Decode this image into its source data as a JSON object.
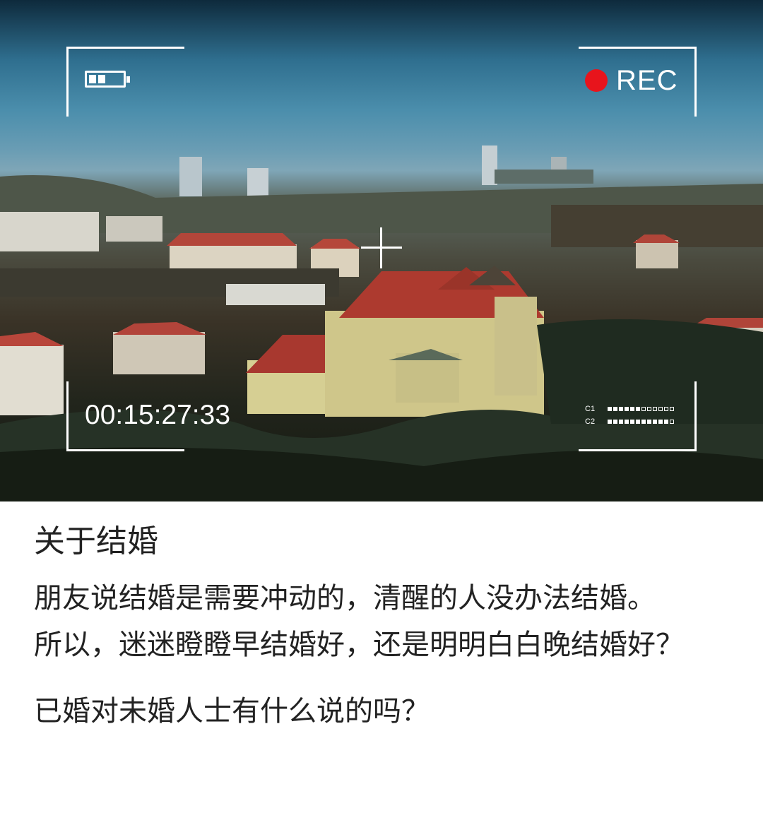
{
  "camera_overlay": {
    "battery_icon": "battery-icon",
    "battery_level": 0.66,
    "rec_label": "REC",
    "rec_color": "#e8141c",
    "timecode": "00:15:27:33",
    "channels": [
      {
        "label": "C1",
        "level": 0.5
      },
      {
        "label": "C2",
        "level": 0.9
      }
    ]
  },
  "post": {
    "title": "关于结婚",
    "paragraphs": [
      "朋友说结婚是需要冲动的，清醒的人没办法结婚。",
      "所以，迷迷瞪瞪早结婚好，还是明明白白晚结婚好？",
      "已婚对未婚人士有什么说的吗？"
    ]
  }
}
